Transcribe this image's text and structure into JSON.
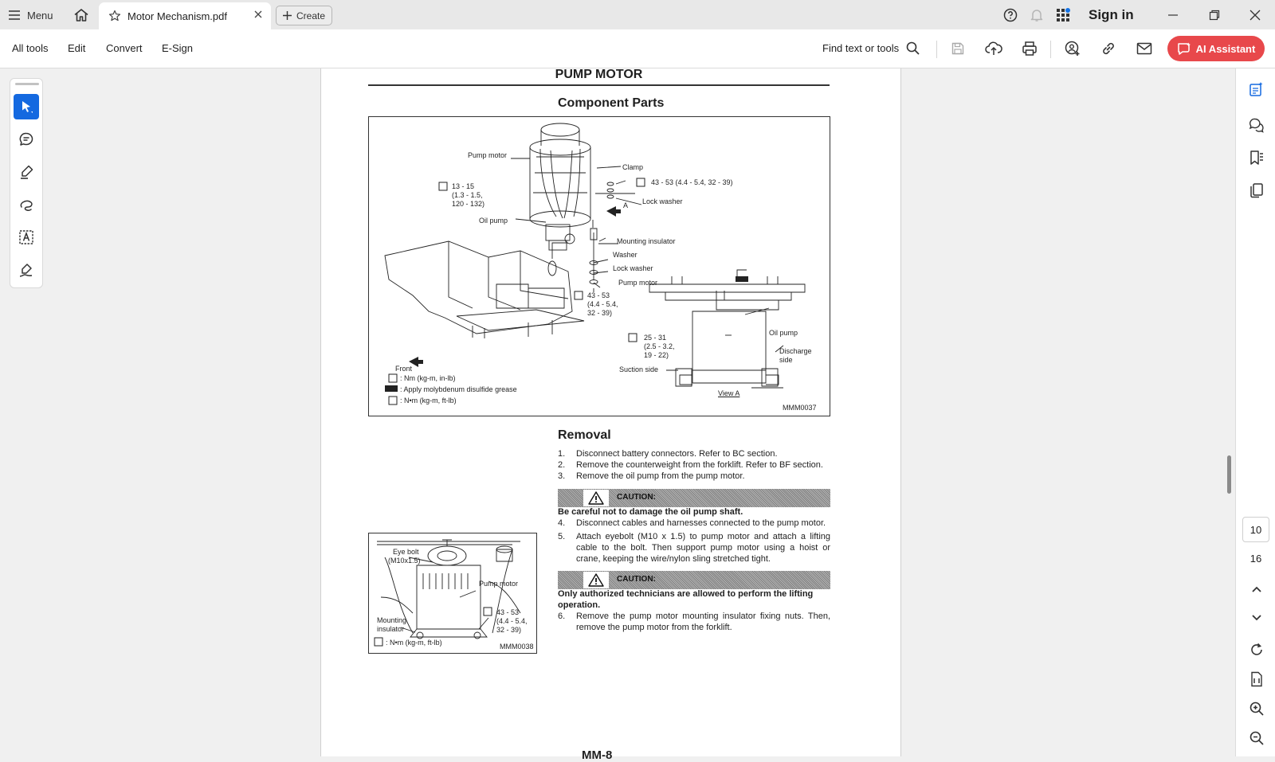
{
  "window": {
    "menu_label": "Menu",
    "tab_title": "Motor Mechanism.pdf",
    "create_label": "Create",
    "signin_label": "Sign in"
  },
  "toolbar": {
    "all_tools": "All tools",
    "edit": "Edit",
    "convert": "Convert",
    "esign": "E-Sign",
    "find_placeholder": "Find text or tools",
    "ai_assistant": "AI Assistant"
  },
  "left_tools": [
    "select-tool",
    "comment-tool",
    "highlight-tool",
    "draw-tool",
    "text-select-tool",
    "sign-tool"
  ],
  "document": {
    "title": "PUMP MOTOR",
    "subtitle": "Component Parts",
    "figure1": {
      "id": "MMM0037",
      "labels": {
        "pump_motor": "Pump motor",
        "clamp": "Clamp",
        "torque_top": "43 - 53 (4.4 - 5.4, 32 - 39)",
        "lock_washer": "Lock washer",
        "arrow_a": "A",
        "torque_left_1": "13 - 15",
        "torque_left_2": "(1.3 - 1.5,",
        "torque_left_3": "120 - 132)",
        "oil_pump": "Oil pump",
        "mounting_insulator": "Mounting insulator",
        "washer": "Washer",
        "lock_washer_2": "Lock washer",
        "pump_motor_b": "Pump motor",
        "torque_mid_1": "43 - 53",
        "torque_mid_2": "(4.4 - 5.4,",
        "torque_mid_3": "32 - 39)",
        "torque_b_1": "25 - 31",
        "torque_b_2": "(2.5 - 3.2,",
        "torque_b_3": "19 - 22)",
        "oil_pump_b": "Oil pump",
        "discharge_1": "Discharge",
        "discharge_2": "side",
        "suction": "Suction side",
        "view_a": "View A",
        "front": "Front"
      },
      "legend": [
        ": Nm (kg-m, in-lb)",
        ": Apply molybdenum disulfide grease",
        ": N•m (kg-m, ft-lb)"
      ]
    },
    "removal_heading": "Removal",
    "steps_a": [
      {
        "n": "1.",
        "t": "Disconnect battery connectors. Refer to BC section."
      },
      {
        "n": "2.",
        "t": "Remove the counterweight from the forklift. Refer to BF section."
      },
      {
        "n": "3.",
        "t": "Remove the oil pump from the pump motor."
      }
    ],
    "caution_label": "CAUTION:",
    "caution_1": "Be careful not to damage the oil pump shaft.",
    "steps_b": [
      {
        "n": "4.",
        "t": "Disconnect cables and harnesses connected to the pump motor."
      },
      {
        "n": "5.",
        "t": "Attach eyebolt (M10 x 1.5) to pump motor and attach a lifting cable to the bolt. Then support pump motor using a hoist or crane, keeping the wire/nylon sling stretched tight."
      }
    ],
    "caution_2": "Only authorized technicians are allowed to perform the lifting operation.",
    "steps_c": [
      {
        "n": "6.",
        "t": "Remove the pump motor mounting insulator fixing nuts. Then, remove the pump motor from the forklift."
      }
    ],
    "figure2": {
      "id": "MMM0038",
      "labels": {
        "eye_bolt_1": "Eye bolt",
        "eye_bolt_2": "(M10x1.5)",
        "pump_motor": "Pump motor",
        "torque_1": "43 - 53",
        "torque_2": "(4.4 - 5.4,",
        "torque_3": "32 - 39)",
        "mount_1": "Mounting",
        "mount_2": "insulator",
        "legend": ": N•m (kg-m, ft-lb)"
      }
    },
    "page_footer": "MM-8"
  },
  "navigation": {
    "current_page": "10",
    "total_pages": "16"
  }
}
